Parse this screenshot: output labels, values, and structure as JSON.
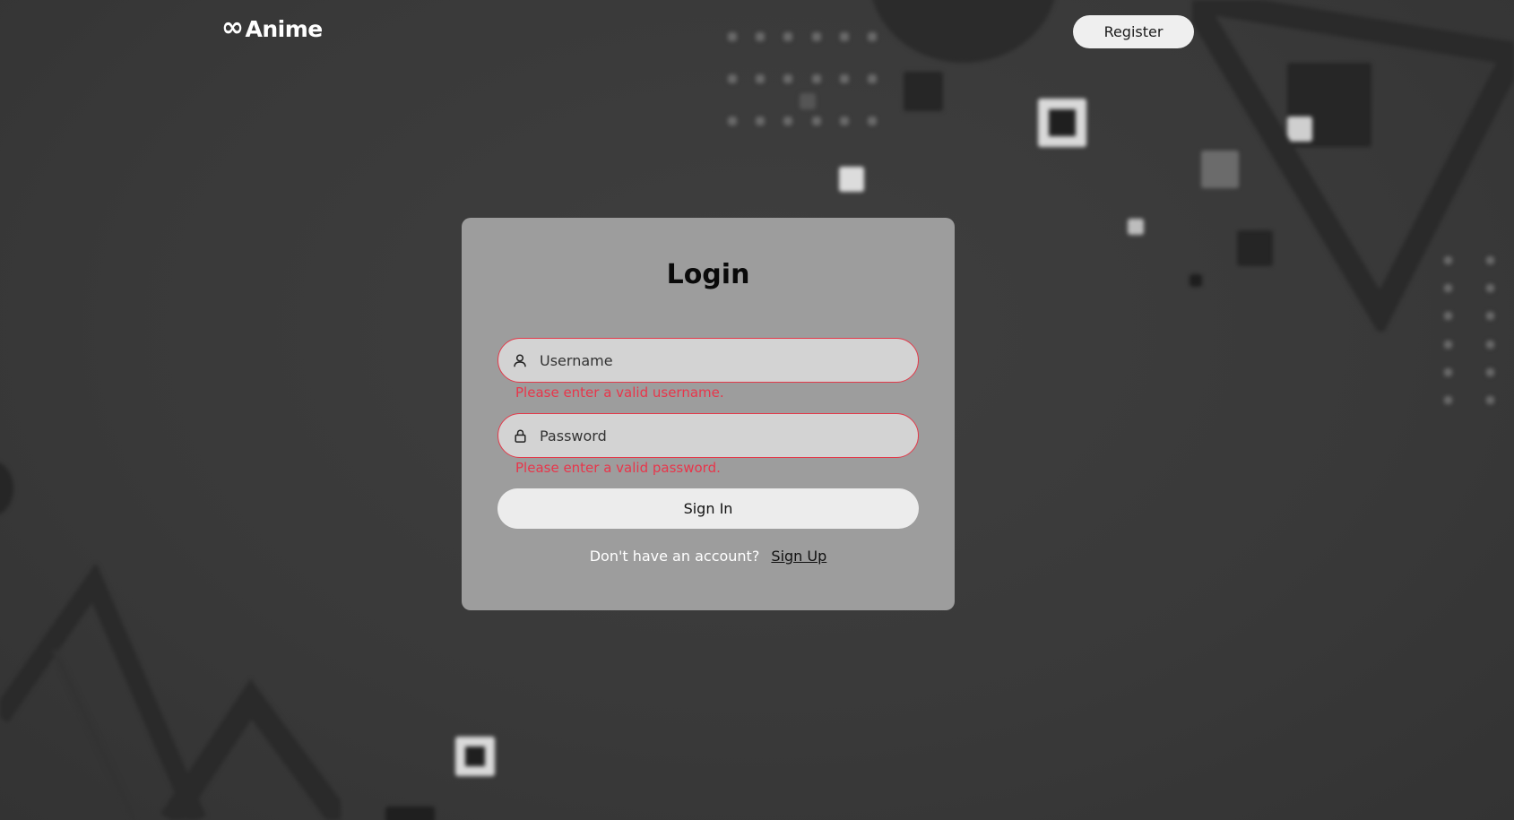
{
  "header": {
    "logo_mark": "∞",
    "logo_text": "Anime",
    "register_label": "Register"
  },
  "login": {
    "title": "Login",
    "username": {
      "placeholder": "Username",
      "value": "",
      "icon": "user-icon",
      "error": "Please enter a valid username."
    },
    "password": {
      "placeholder": "Password",
      "value": "",
      "icon": "lock-icon",
      "error": "Please enter a valid password."
    },
    "signin_label": "Sign In",
    "signup_prompt": "Don't have an account?",
    "signup_link": "Sign Up"
  },
  "colors": {
    "background": "#3a3a3a",
    "card": "#9d9d9d",
    "input_fill": "#d3d3d3",
    "error": "#e8364b",
    "button": "#ececec"
  }
}
